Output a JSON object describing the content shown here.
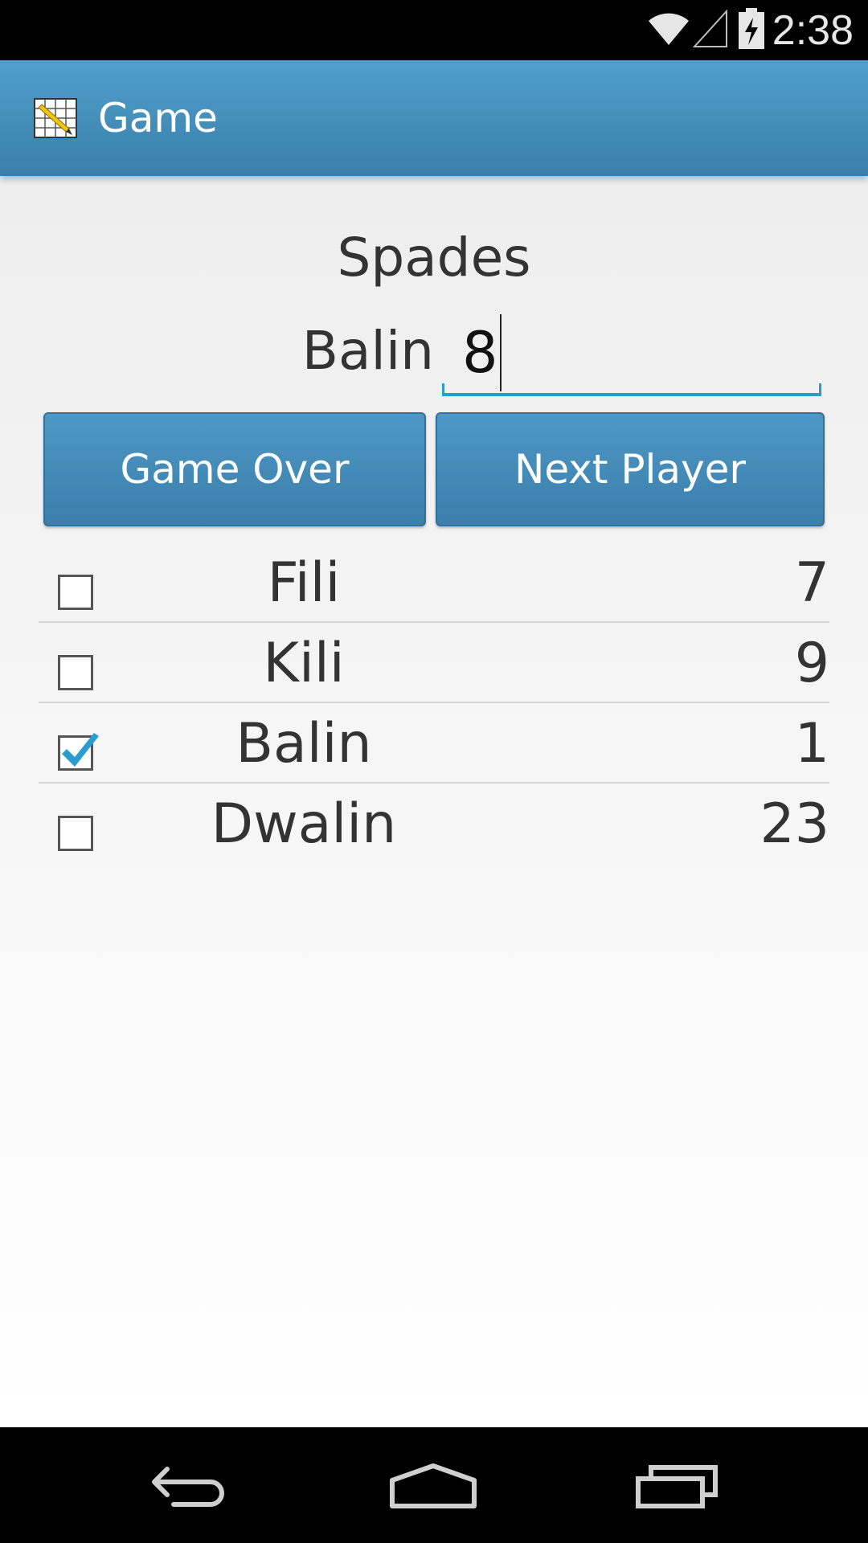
{
  "status_bar": {
    "time": "2:38",
    "icons": [
      "wifi-icon",
      "signal-icon",
      "battery-charging-icon"
    ]
  },
  "app_bar": {
    "title": "Game",
    "icon": "score-sheet-icon",
    "color": "#4a92c0"
  },
  "game": {
    "name": "Spades",
    "current_player": "Balin",
    "score_input_value": "8"
  },
  "buttons": {
    "game_over": "Game Over",
    "next_player": "Next Player"
  },
  "players": [
    {
      "name": "Fili",
      "score": "7",
      "checked": false
    },
    {
      "name": "Kili",
      "score": "9",
      "checked": false
    },
    {
      "name": "Balin",
      "score": "1",
      "checked": true
    },
    {
      "name": "Dwalin",
      "score": "23",
      "checked": false
    }
  ],
  "nav_bar": {
    "icons": [
      "back-icon",
      "home-icon",
      "recents-icon"
    ]
  },
  "colors": {
    "accent": "#2a9dd0",
    "button": "#4487b6"
  }
}
